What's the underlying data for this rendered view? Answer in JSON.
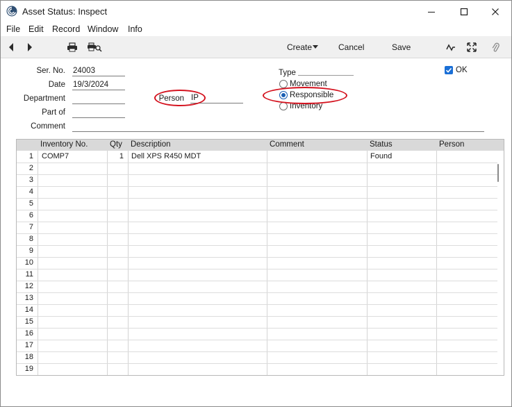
{
  "window": {
    "title": "Asset Status: Inspect",
    "icons": [
      "app-logo-icon",
      "minimize-icon",
      "maximize-icon",
      "close-icon"
    ]
  },
  "menu": [
    "File",
    "Edit",
    "Record",
    "Window",
    "Info"
  ],
  "toolbar": {
    "create_label": "Create",
    "cancel_label": "Cancel",
    "save_label": "Save",
    "icons": [
      "prev-record-icon",
      "next-record-icon",
      "print-icon",
      "print-preview-icon",
      "activity-icon",
      "expand-icon",
      "attachment-icon"
    ]
  },
  "form": {
    "serno_label": "Ser. No.",
    "serno_value": "24003",
    "date_label": "Date",
    "date_value": "19/3/2024",
    "department_label": "Department",
    "department_value": "",
    "partof_label": "Part of",
    "partof_value": "",
    "comment_label": "Comment",
    "comment_value": "",
    "person_label": "Person",
    "person_value": "IP",
    "type_label": "Type",
    "type_options": [
      "Movement",
      "Responsible",
      "Inventory"
    ],
    "type_selected": "Responsible",
    "ok_label": "OK",
    "ok_checked": true,
    "highlight_color": "#d4121e"
  },
  "grid": {
    "columns": [
      "Inventory No.",
      "Qty",
      "Description",
      "Comment",
      "Status",
      "Person"
    ],
    "row_numbers": [
      "1",
      "2",
      "3",
      "4",
      "5",
      "6",
      "7",
      "8",
      "9",
      "10",
      "11",
      "12",
      "13",
      "14",
      "15",
      "16",
      "17",
      "18",
      "19"
    ],
    "rows": [
      {
        "inventory_no": "COMP7",
        "qty": "1",
        "description": "Dell XPS R450 MDT",
        "comment": "",
        "status": "Found",
        "person": ""
      }
    ]
  }
}
